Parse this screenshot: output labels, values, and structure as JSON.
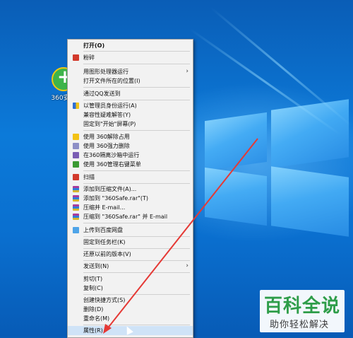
{
  "desktop_icon": {
    "label": "360安全"
  },
  "menu": {
    "items": [
      {
        "label": "打开(O)",
        "bold": true,
        "icon": ""
      },
      {
        "label": "粉碎",
        "icon": "360-shred-icon"
      },
      {
        "label": "用图形处理器运行",
        "submenu": true
      },
      {
        "label": "打开文件所在的位置(I)"
      },
      {
        "label": "通过QQ发送到"
      },
      {
        "label": "以管理员身份运行(A)",
        "icon": "uac-shield-icon"
      },
      {
        "label": "兼容性疑难解答(Y)"
      },
      {
        "label": "固定到\"开始\"屏幕(P)"
      },
      {
        "label": "使用 360解除占用",
        "icon": "360-icon"
      },
      {
        "label": "使用 360强力删除",
        "icon": "360-ball-icon"
      },
      {
        "label": "在360隔离沙箱中运行",
        "icon": "sandbox-icon"
      },
      {
        "label": "使用 360管理右键菜单",
        "icon": "360-gear-icon"
      },
      {
        "label": "扫描",
        "icon": "360-scan-icon"
      },
      {
        "label": "添加到压缩文件(A)...",
        "icon": "winrar-icon"
      },
      {
        "label": "添加到 \"360Safe.rar\"(T)",
        "icon": "winrar-icon"
      },
      {
        "label": "压缩并 E-mail...",
        "icon": "winrar-icon"
      },
      {
        "label": "压缩到 \"360Safe.rar\" 并 E-mail",
        "icon": "winrar-icon"
      },
      {
        "label": "上传到百度网盘",
        "icon": "baidu-cloud-icon"
      },
      {
        "label": "固定到任务栏(K)"
      },
      {
        "label": "还原以前的版本(V)"
      },
      {
        "label": "发送到(N)",
        "submenu": true
      },
      {
        "label": "剪切(T)"
      },
      {
        "label": "复制(C)"
      },
      {
        "label": "创建快捷方式(S)"
      },
      {
        "label": "删除(D)"
      },
      {
        "label": "重命名(M)"
      },
      {
        "label": "属性(R)"
      }
    ]
  },
  "watermark": {
    "title": "百科全说",
    "subtitle": "助你轻松解决"
  },
  "colors": {
    "arrow": "#e53935",
    "watermark_green": "#2e9d49"
  }
}
